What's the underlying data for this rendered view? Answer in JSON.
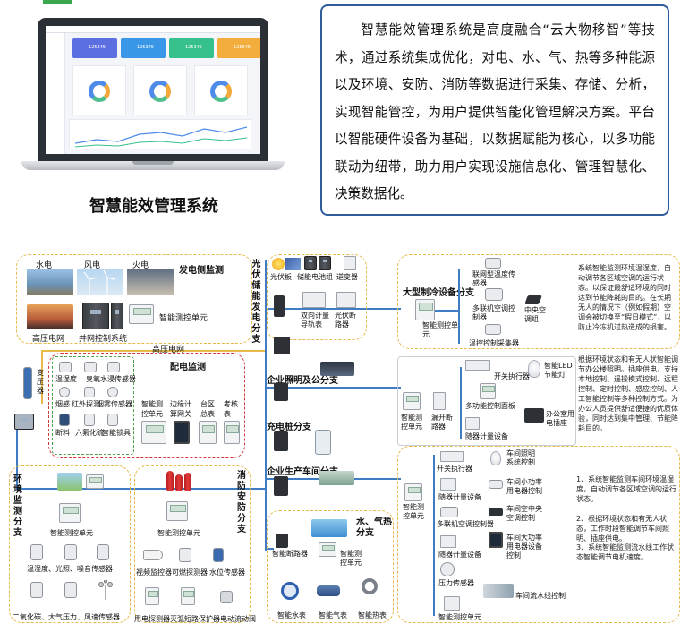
{
  "top": {
    "title": "智慧能效管理系统",
    "description": "智慧能效管理系统是高度融合“云大物移智”等技术，通过系统集成优化，对电、水、气、热等多种能源以及环境、安防、消防等数据进行采集、存储、分析，实现智能管控，为用户提供智能化管理解决方案。平台以智能硬件设备为基础，以数据赋能为核心，以多功能联动为纽带，助力用户实现设施信息化、管理智慧化、决策数据化。",
    "dashboard_values": [
      "125345",
      "125345",
      "125345",
      "125345"
    ]
  },
  "generation": {
    "title": "发电侧监测",
    "hydro": "水电",
    "wind": "风电",
    "thermal": "火电",
    "hv_grid": "高压电网",
    "grid_tie": "并网控制系统",
    "controller": "智能测控单元"
  },
  "hv_label": "高压电网",
  "transformer": "变压器",
  "distribution": {
    "title": "配电监测",
    "sensors": [
      "温湿度",
      "臭氧",
      "水浸传感器",
      "烟感",
      "红外探测",
      "烟雾传感器",
      "断料",
      "六氟化硫",
      "智能锁具"
    ],
    "devices": [
      "智能测控单元",
      "边缘计算网关",
      "台区总表",
      "考核表"
    ]
  },
  "pv": {
    "title": "光伏储能发电分支",
    "items": [
      "光伏板",
      "储能电池组",
      "逆变器",
      "双向计量导轨表",
      "光伏断路器"
    ]
  },
  "hvac": {
    "title": "大型制冷设备分支",
    "items": [
      "联网型温度传感器",
      "多联机空调控制器",
      "中央空调组",
      "温控控制采集器",
      "智能测控单元"
    ],
    "note": "系统智能监测环境温湿度，自动调节各区域空调的运行状态。以保证最舒适环境的同时达到节能降耗的目的。在长期无人的情况下（例如假期）空调会被切换至“假日模式”，以防止冷冻机过热造成的损害。"
  },
  "lighting": {
    "title": "企业照明及公分支",
    "items": [
      "开关执行器",
      "智能LED节能灯",
      "多功能控制面板",
      "办公室用电插座",
      "随器计量设备",
      "智能测控单元",
      "漏开断路器"
    ],
    "note": "根据环境状态和有无人状智能调节办公楼照明。插座供电，支持本地控制、遥操模式控制、远程控制、定时控制、感应控制、人工智能控制等多种控制方式。为办公人员提供舒适便捷的优质体验，同时达到集中管理、节能降耗目的。"
  },
  "charging": {
    "title": "充电桩分支"
  },
  "workshop": {
    "title": "企业生产车间分支",
    "items": [
      "车间照明系统控制",
      "开关执行器",
      "车间小功率用电器控制",
      "随器计量设备",
      "车间空中央空调控制",
      "多联机空调控制器",
      "车间大功率用电器设备控制",
      "随器计量设备",
      "压力传感器",
      "车间流水线控制",
      "智能测控单元",
      "智能测控单元"
    ],
    "notes": [
      "1、系统智能监测车间环境温湿度，自动调节各区域空调的运行状态。",
      "2、根据环境状态和有无人状态，工作时段智能调节车间照明、插座供电。",
      "3、系统智能监测流水线工作状态智能调节电机速度。"
    ]
  },
  "env": {
    "title": "环境监测分支",
    "controller": "智能测控单元",
    "sensors": [
      "温湿度、光照、噪音传感器",
      "二氧化碳、大气压力、风速传感器"
    ]
  },
  "fire": {
    "title": "消防安防分支",
    "controller": "智能测控单元",
    "items": [
      "视频监控器",
      "可燃探测器",
      "水位传感器",
      "用电探测器",
      "灭弧短路保护器",
      "电动流动阀"
    ]
  },
  "utility": {
    "title": "水、气热分支",
    "items": [
      "智能断路器",
      "智能测控单元",
      "智能水表",
      "智能气表",
      "智能热表"
    ]
  }
}
